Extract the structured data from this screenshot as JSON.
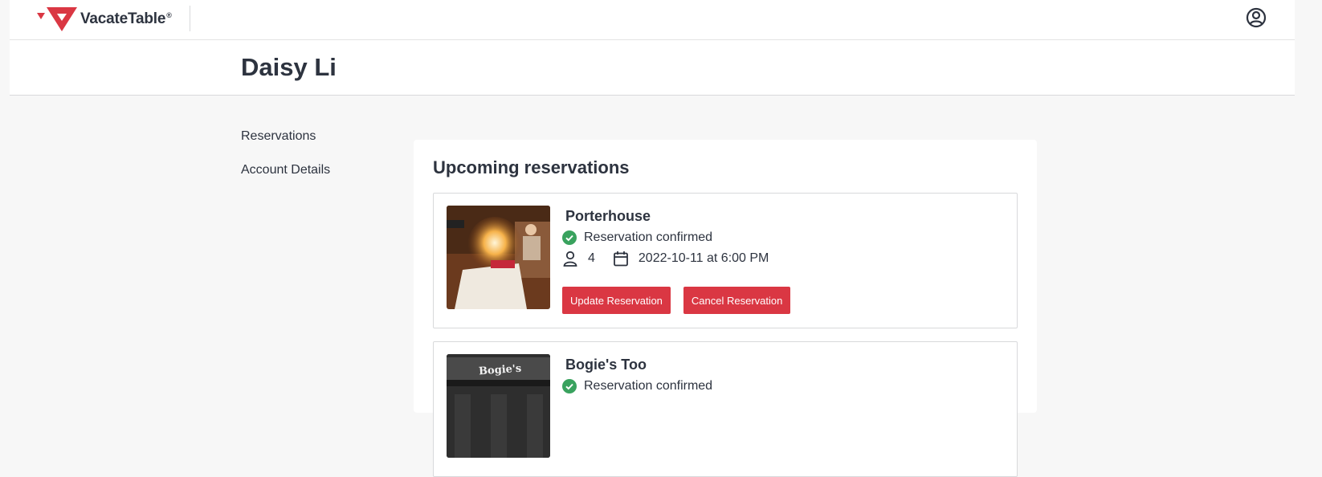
{
  "brand": {
    "name": "VacateTable",
    "reg": "®"
  },
  "header": {
    "user_name": "Daisy Li"
  },
  "nav": {
    "items": [
      {
        "label": "Reservations"
      },
      {
        "label": "Account Details"
      }
    ]
  },
  "main": {
    "title": "Upcoming reservations",
    "reservations": [
      {
        "restaurant": "Porterhouse",
        "status": "Reservation confirmed",
        "party_size": "4",
        "datetime": "2022-10-11 at 6:00 PM",
        "update_label": "Update Reservation",
        "cancel_label": "Cancel Reservation"
      },
      {
        "restaurant": "Bogie's Too",
        "status": "Reservation confirmed",
        "sign_text": "Bogie's"
      }
    ]
  },
  "colors": {
    "brand_red": "#da3743",
    "confirmed_green": "#39a25e",
    "text": "#2d333f"
  },
  "icons": {
    "user": "user-circle-icon",
    "check": "check-circle-icon",
    "person": "person-icon",
    "calendar": "calendar-icon"
  }
}
